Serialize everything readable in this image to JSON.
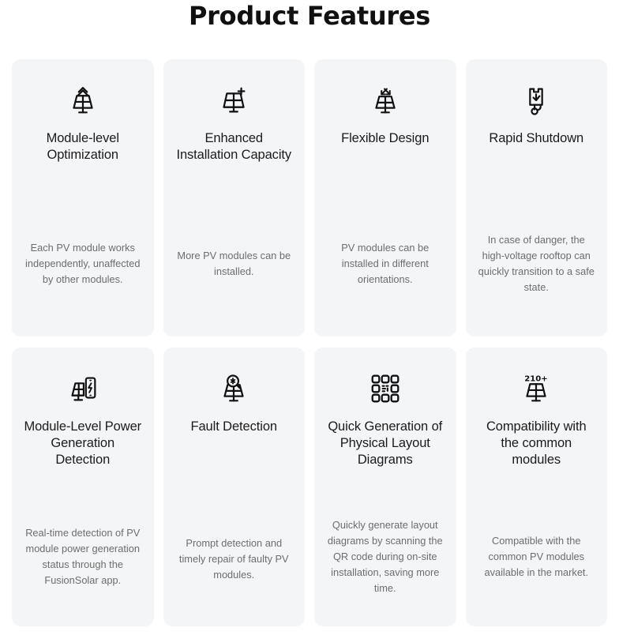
{
  "page": {
    "title": "Product Features",
    "background_color": "#ffffff",
    "card_background_color": "#f4f5f7",
    "heading_color": "#1b1b1b",
    "body_text_color": "#6d6d6d",
    "icon_color": "#111111"
  },
  "cards": [
    {
      "icon_name": "solar-panel-optimization-icon",
      "heading": "Module-level Optimization",
      "body": "Each PV module works independently, unaffected by other modules."
    },
    {
      "icon_name": "solar-panel-plus-icon",
      "heading": "Enhanced Installation Capacity",
      "body": "More PV modules can be installed."
    },
    {
      "icon_name": "solar-panel-expand-arrows-icon",
      "heading": "Flexible Design",
      "body": "PV modules can be installed in different orientations."
    },
    {
      "icon_name": "rapid-shutdown-device-icon",
      "heading": "Rapid Shutdown",
      "body": "In case of danger, the high-voltage rooftop can quickly transition to a safe state."
    },
    {
      "icon_name": "solar-panel-phone-icon",
      "heading": "Module-Level Power Generation Detection",
      "body": "Real-time detection of PV module power generation status through the FusionSolar app."
    },
    {
      "icon_name": "solar-panel-magnifier-icon",
      "heading": "Fault Detection",
      "body": "Prompt detection and timely repair of faulty PV modules."
    },
    {
      "icon_name": "qr-code-icon",
      "heading": "Quick Generation of Physical Layout Diagrams",
      "body": "Quickly generate layout diagrams by scanning the QR code during on-site installation, saving more time."
    },
    {
      "icon_name": "solar-panel-210-plus-icon",
      "heading": "Compatibility with the common modules",
      "body": "Compatible with the common PV modules available in the market.",
      "icon_badge": "210+"
    }
  ]
}
